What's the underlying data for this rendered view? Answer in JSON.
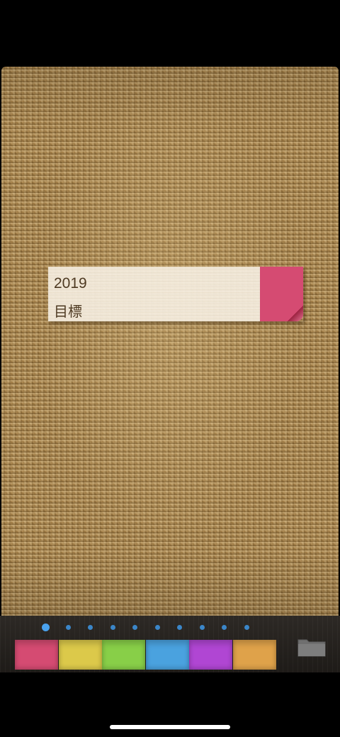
{
  "board": {
    "background": "woven-cork-texture"
  },
  "note": {
    "line1": "2019",
    "line2": "目標",
    "tab_color": "#d54b72"
  },
  "pager": {
    "total_pages": 10,
    "current_page": 1,
    "active_color": "#4aa2ee",
    "inactive_color": "#3b86c8"
  },
  "palette": {
    "colors": [
      {
        "name": "pink",
        "hex": "#d54b72"
      },
      {
        "name": "yellow",
        "hex": "#dcc94a"
      },
      {
        "name": "green",
        "hex": "#88cf48"
      },
      {
        "name": "blue",
        "hex": "#4aa2df"
      },
      {
        "name": "purple",
        "hex": "#b046d3"
      },
      {
        "name": "orange",
        "hex": "#dfa24a"
      }
    ]
  },
  "folder": {
    "icon": "folder-icon"
  }
}
